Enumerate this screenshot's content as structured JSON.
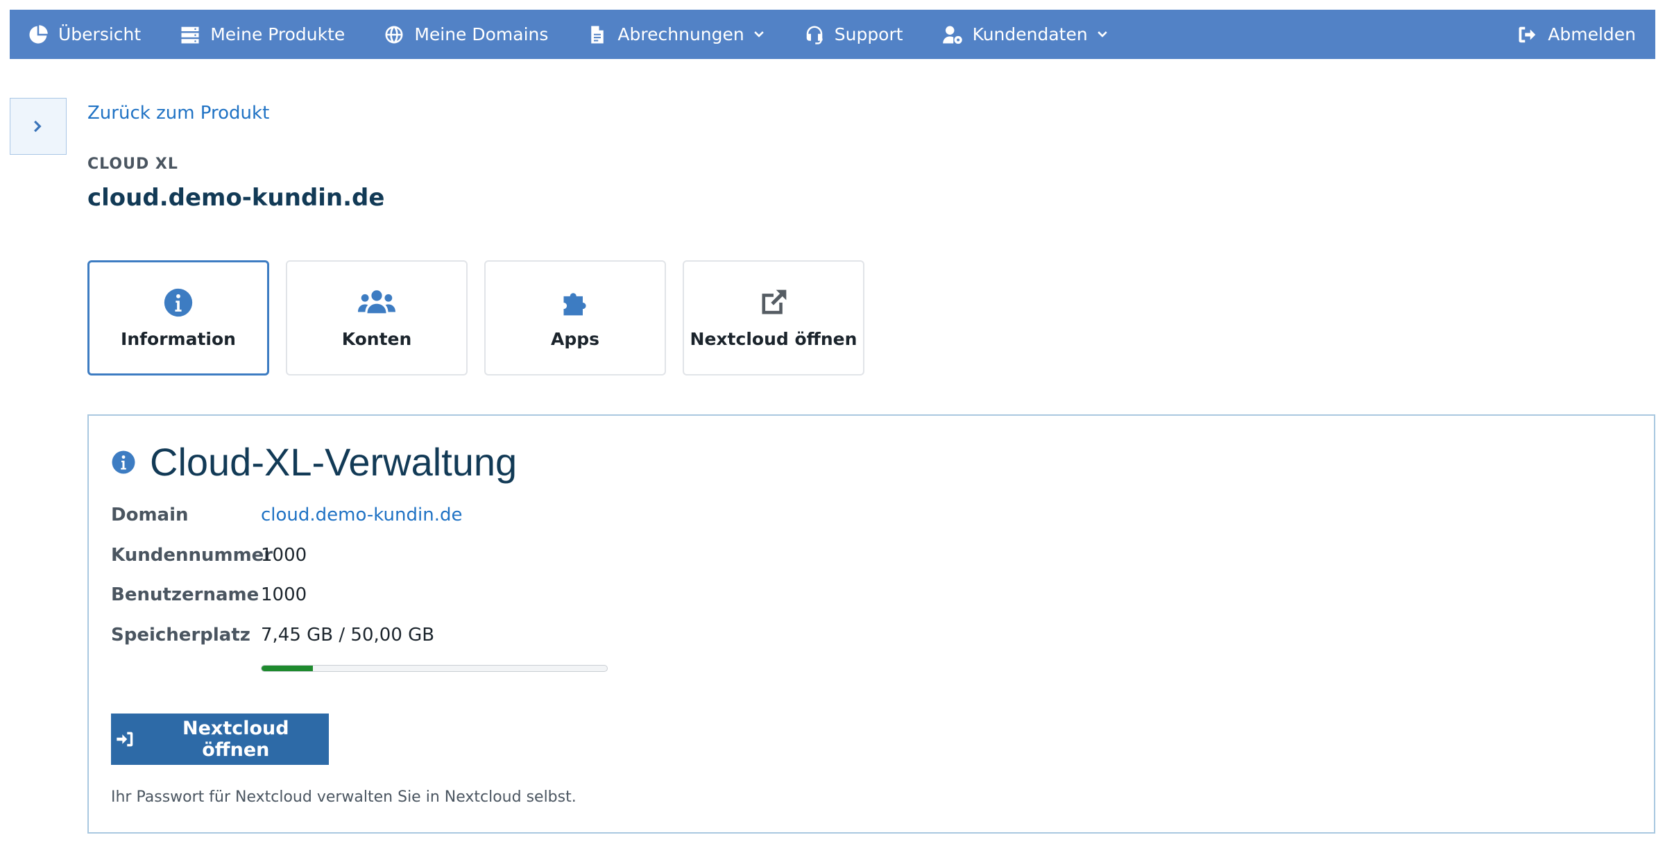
{
  "nav": {
    "items": [
      {
        "label": "Übersicht",
        "icon": "pie-chart-icon"
      },
      {
        "label": "Meine Produkte",
        "icon": "server-icon"
      },
      {
        "label": "Meine Domains",
        "icon": "globe-icon"
      },
      {
        "label": "Abrechnungen",
        "icon": "invoice-icon",
        "dropdown": true
      },
      {
        "label": "Support",
        "icon": "headset-icon"
      },
      {
        "label": "Kundendaten",
        "icon": "user-cog-icon",
        "dropdown": true
      }
    ],
    "logout": {
      "label": "Abmelden",
      "icon": "sign-out-icon"
    },
    "background_color": "#5282c6"
  },
  "back_link": "Zurück zum Produkt",
  "product": {
    "type_label": "CLOUD XL",
    "domain": "cloud.demo-kundin.de"
  },
  "tiles": [
    {
      "label": "Information",
      "icon": "info-circle-icon",
      "active": true
    },
    {
      "label": "Konten",
      "icon": "users-icon"
    },
    {
      "label": "Apps",
      "icon": "puzzle-icon"
    },
    {
      "label": "Nextcloud öffnen",
      "icon": "external-link-icon"
    }
  ],
  "panel": {
    "title": "Cloud-XL-Verwaltung",
    "rows": [
      {
        "label": "Domain",
        "value": "cloud.demo-kundin.de"
      },
      {
        "label": "Kundennummer",
        "value": "1000"
      },
      {
        "label": "Benutzername",
        "value": "1000"
      },
      {
        "label": "Speicherplatz",
        "value": "7,45 GB / 50,00 GB"
      }
    ],
    "storage_used_fraction": 0.149,
    "button_label": "Nextcloud öffnen",
    "hint": "Ihr Passwort für Nextcloud verwalten Sie in Nextcloud selbst."
  },
  "colors": {
    "accent": "#2d6aa7",
    "link": "#1f72c4",
    "progress": "#1e8a2e"
  }
}
